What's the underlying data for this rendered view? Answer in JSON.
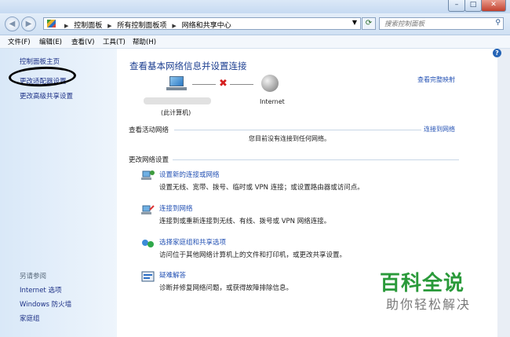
{
  "window": {
    "minimize_label": "–",
    "maximize_label": "□",
    "close_label": "✕"
  },
  "address_bar": {
    "back_icon": "back-arrow-icon",
    "forward_icon": "forward-arrow-icon",
    "breadcrumbs": [
      "控制面板",
      "所有控制面板项",
      "网络和共享中心"
    ],
    "search_placeholder": "搜索控制面板"
  },
  "menu": [
    "文件(F)",
    "编辑(E)",
    "查看(V)",
    "工具(T)",
    "帮助(H)"
  ],
  "sidebar": {
    "items": [
      "控制面板主页",
      "更改适配器设置",
      "更改高级共享设置"
    ],
    "see_also_title": "另请参阅",
    "see_also": [
      "Internet 选项",
      "Windows 防火墙",
      "家庭组"
    ]
  },
  "main": {
    "title": "查看基本网络信息并设置连接",
    "full_map_link": "查看完整映射",
    "computer_label": "(此计算机)",
    "internet_label": "Internet",
    "active_networks_heading": "查看活动网络",
    "connect_link": "连接到网络",
    "no_connection_text": "您目前没有连接到任何网络。",
    "change_settings_heading": "更改网络设置",
    "tasks": [
      {
        "title": "设置新的连接或网络",
        "desc": "设置无线、宽带、拨号、临时或 VPN 连接；或设置路由器或访问点。",
        "icon": "new-connection-icon"
      },
      {
        "title": "连接到网络",
        "desc": "连接到或重新连接到无线、有线、拨号或 VPN 网络连接。",
        "icon": "connect-network-icon"
      },
      {
        "title": "选择家庭组和共享选项",
        "desc": "访问位于其他网络计算机上的文件和打印机，或更改共享设置。",
        "icon": "homegroup-icon"
      },
      {
        "title": "疑难解答",
        "desc": "诊断并修复网络问题，或获得故障排除信息。",
        "icon": "troubleshoot-icon"
      }
    ]
  },
  "watermark": {
    "title": "百科全说",
    "subtitle": "助你轻松解决"
  }
}
